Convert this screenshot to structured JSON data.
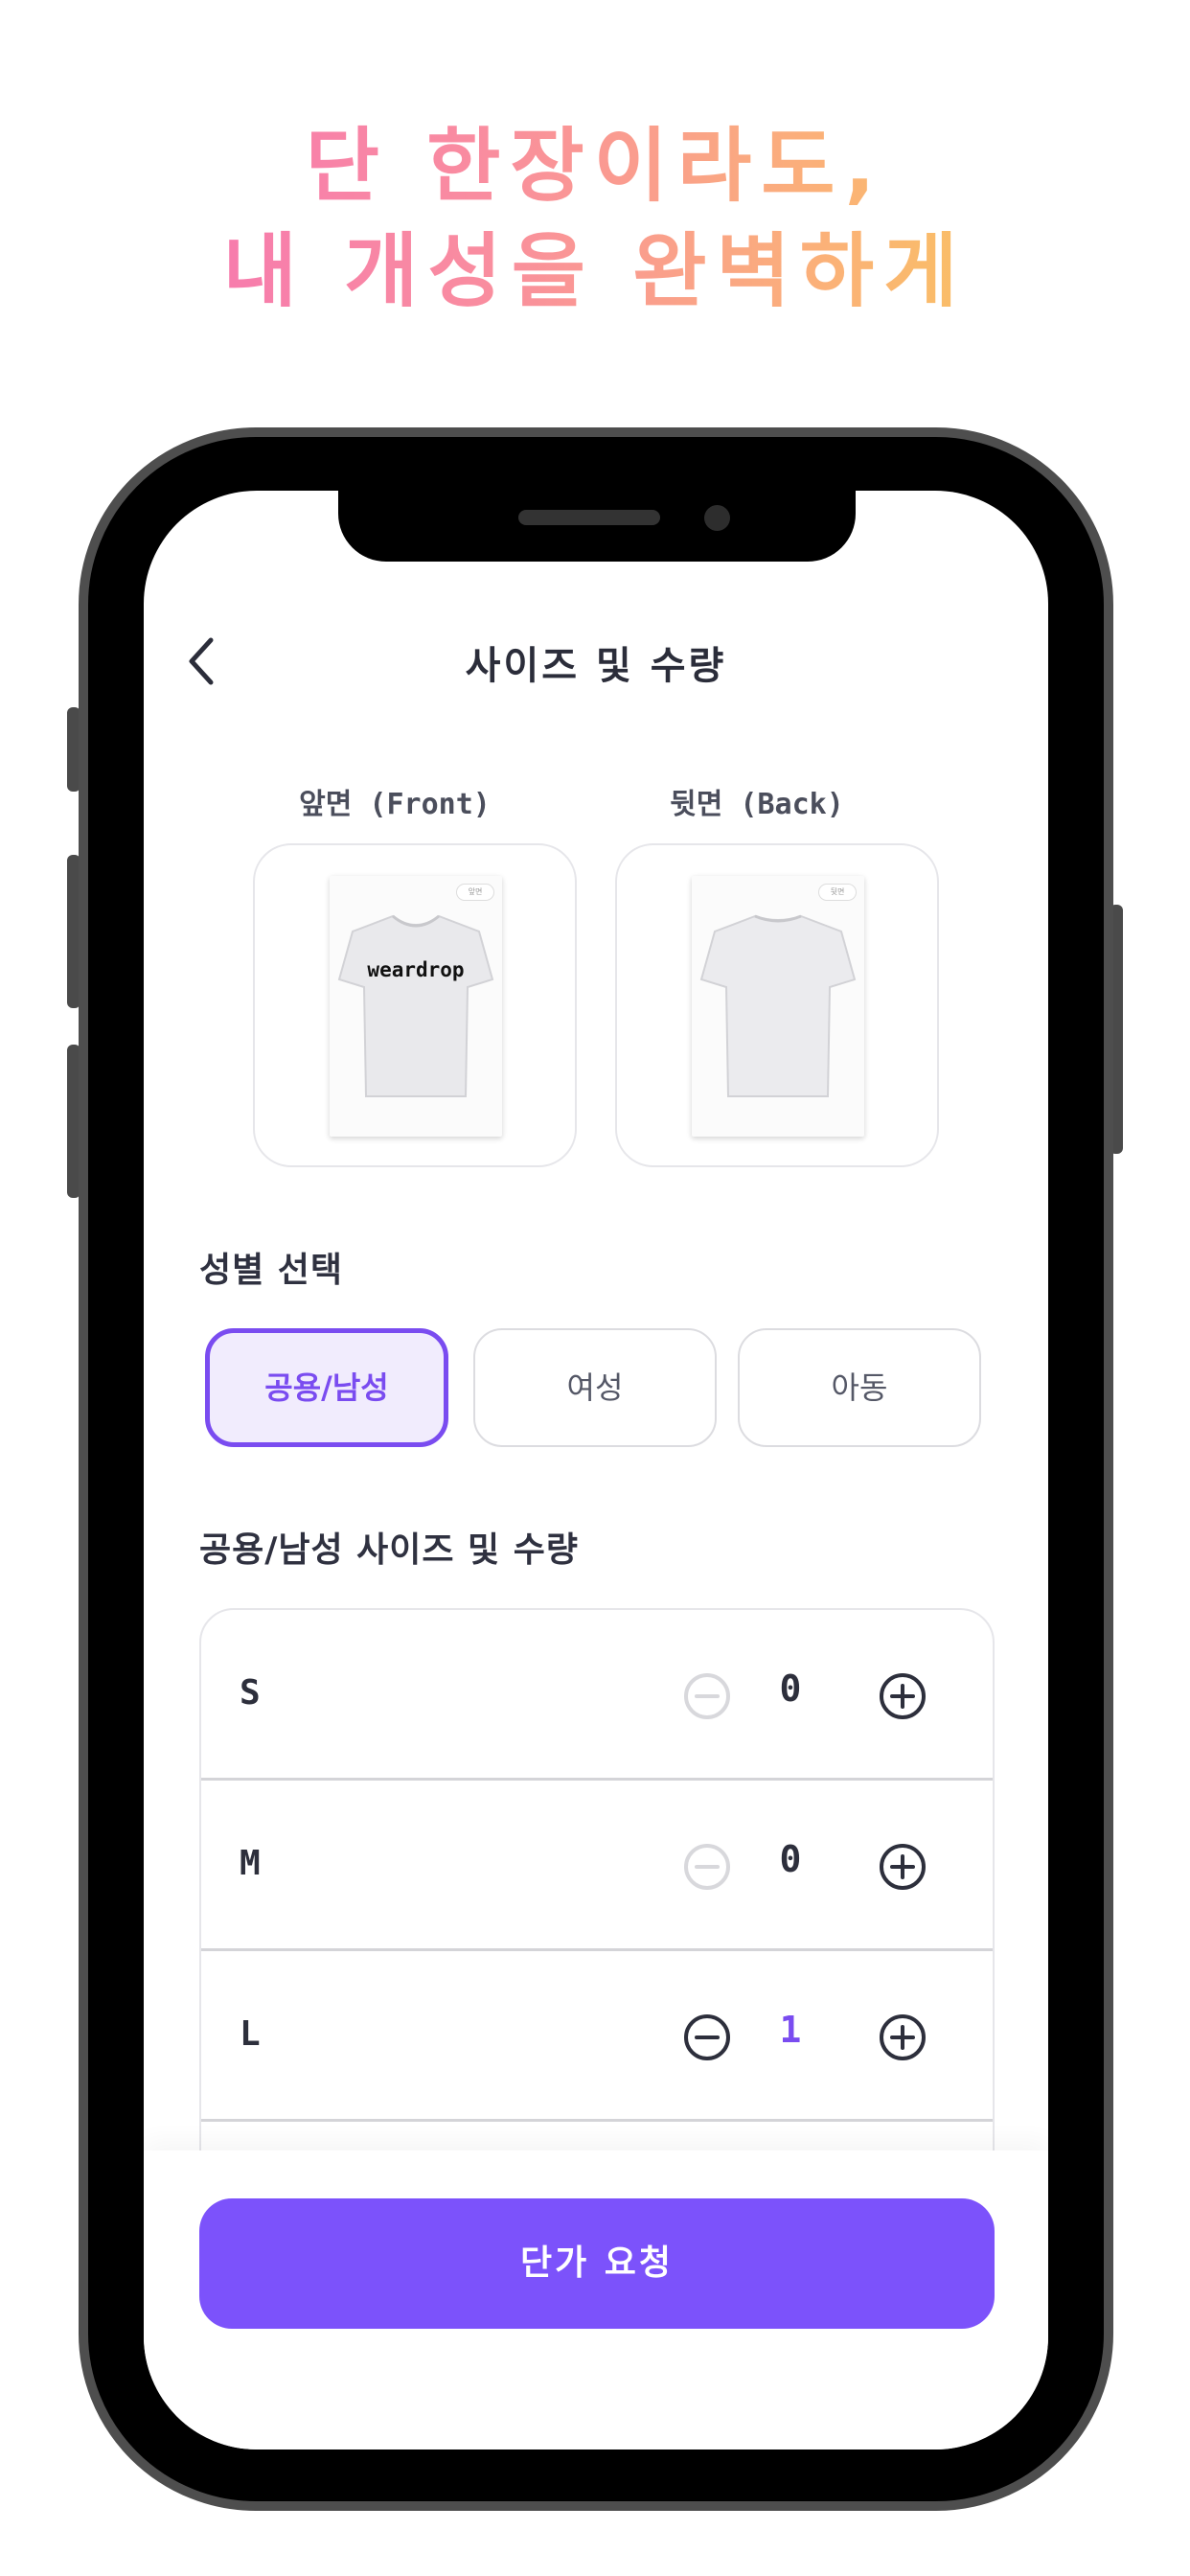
{
  "headline": {
    "line1": "단 한장이라도,",
    "line2": "내 개성을 완벽하게"
  },
  "header": {
    "title": "사이즈 및 수량",
    "back_icon": "chevron-left-icon"
  },
  "preview": {
    "front_label": "앞면 (Front)",
    "back_label": "뒷면 (Back)",
    "front_badge": "앞면",
    "back_badge": "뒷면",
    "front_logo": "weardrop"
  },
  "gender": {
    "title": "성별 선택",
    "options": [
      "공용/남성",
      "여성",
      "아동"
    ],
    "selected": "공용/남성"
  },
  "sizes": {
    "title": "공용/남성 사이즈 및 수량",
    "rows": [
      {
        "label": "S",
        "qty": "0"
      },
      {
        "label": "M",
        "qty": "0"
      },
      {
        "label": "L",
        "qty": "1"
      }
    ]
  },
  "cta": {
    "label": "단가 요청"
  },
  "colors": {
    "accent": "#7c52fb",
    "selected_bg": "#f1ecfd",
    "headline_gradient": [
      "#f56fb8",
      "#fbb277",
      "#f6d24c"
    ]
  }
}
